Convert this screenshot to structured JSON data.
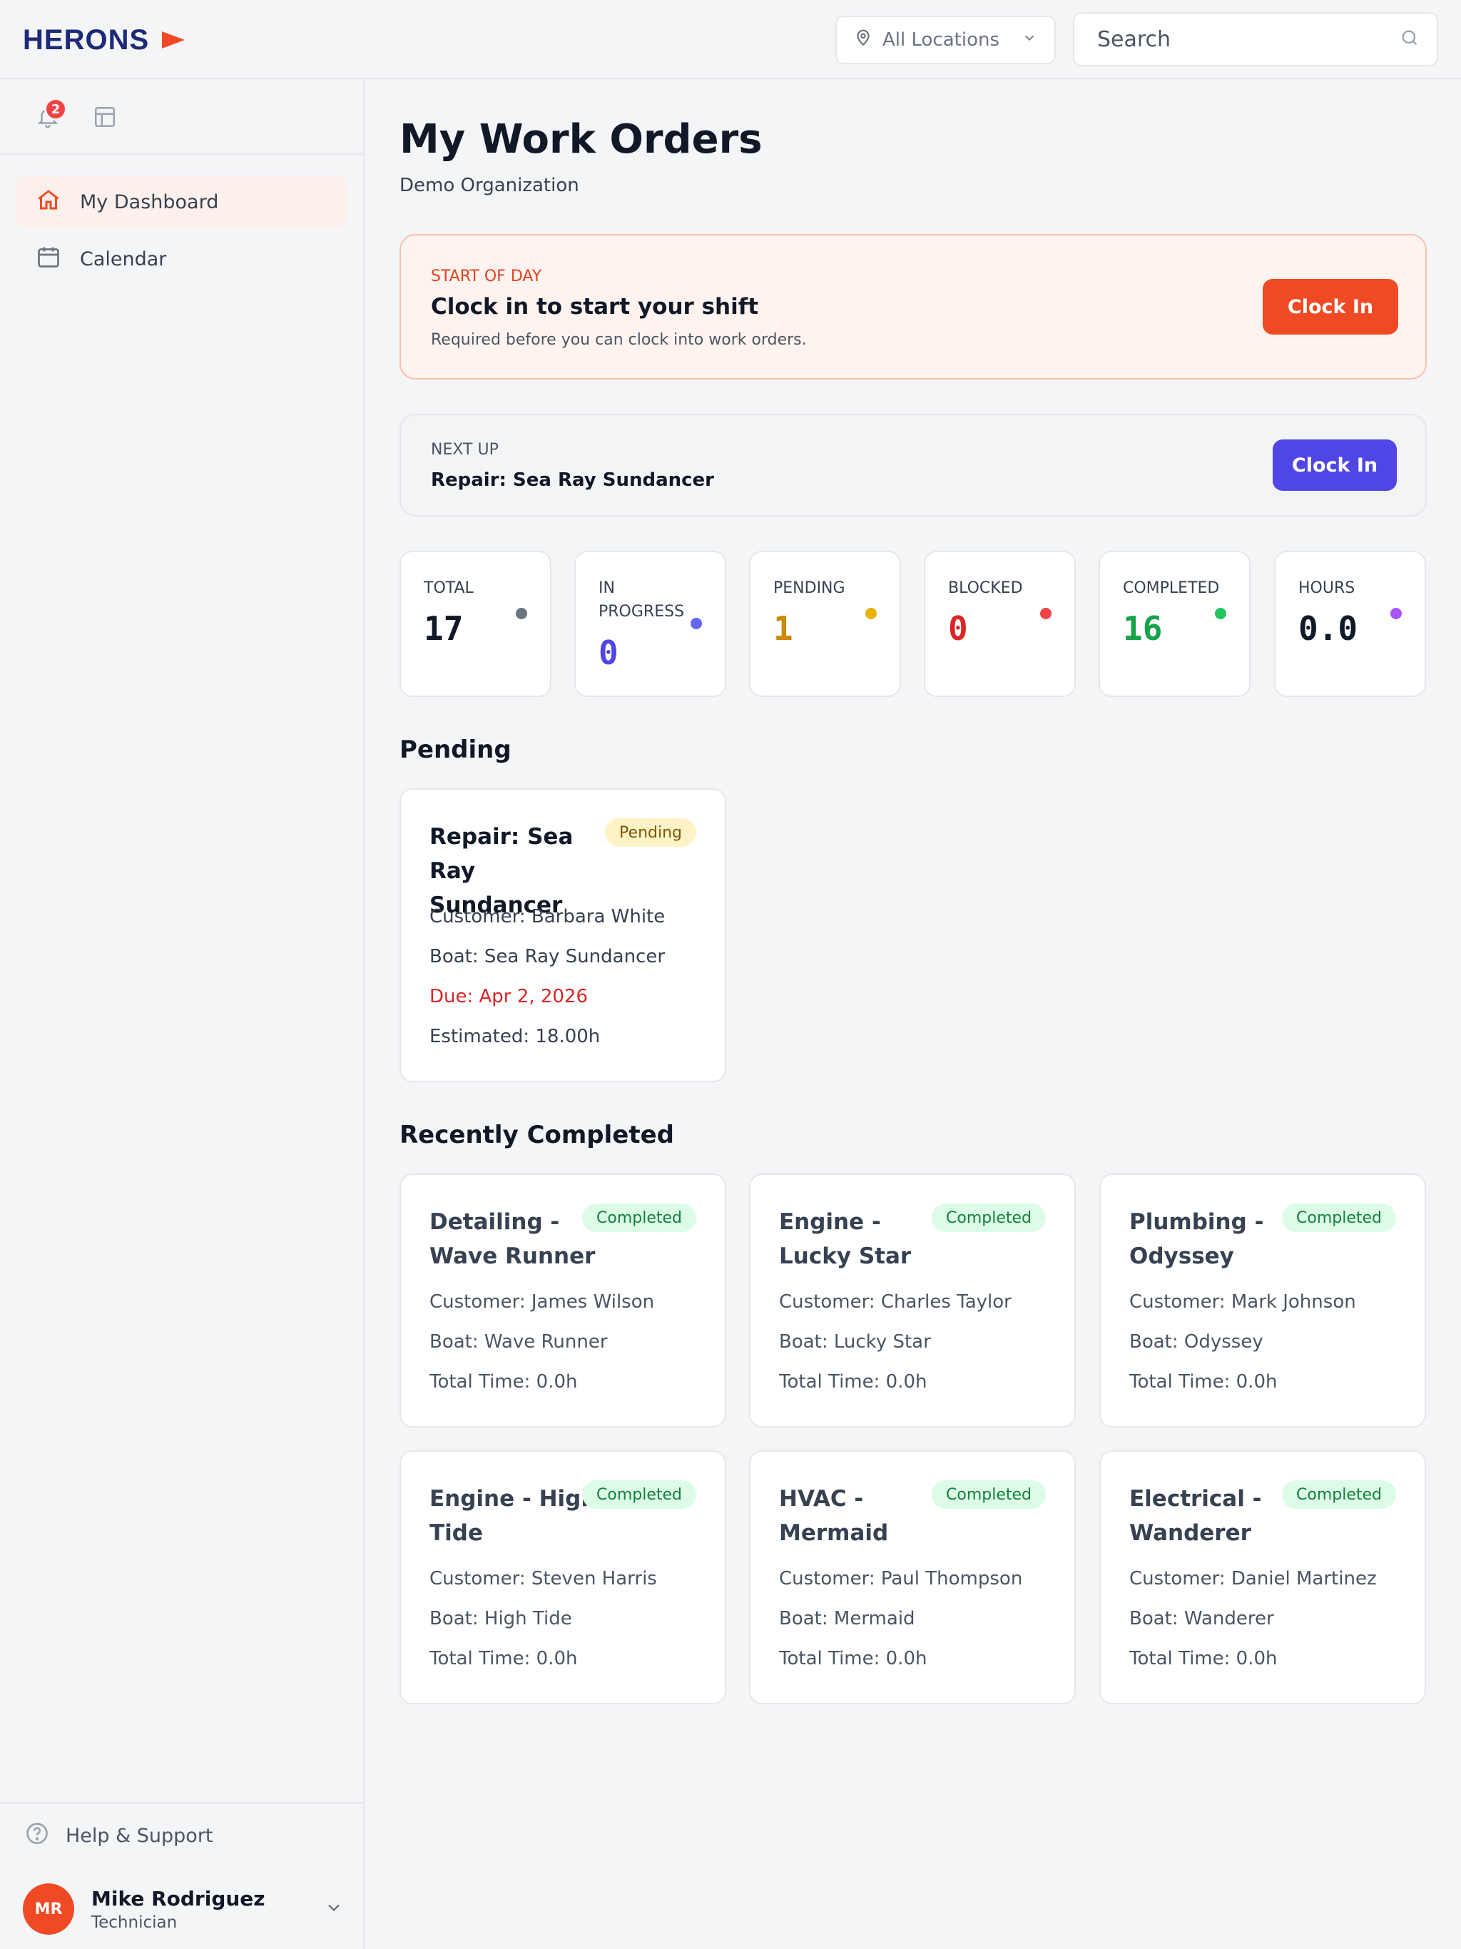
{
  "brand": {
    "name": "HERONS",
    "accent": "#f04a24",
    "navy": "#1e2a78"
  },
  "topbar": {
    "location_label": "All Locations",
    "search_placeholder": "Search"
  },
  "sidebar": {
    "notification_count": "2",
    "items": [
      {
        "label": "My Dashboard",
        "icon": "home-icon",
        "active": true
      },
      {
        "label": "Calendar",
        "icon": "calendar-icon",
        "active": false
      }
    ],
    "help_label": "Help & Support",
    "user": {
      "initials": "MR",
      "name": "Mike Rodriguez",
      "role": "Technician"
    }
  },
  "page": {
    "title": "My Work Orders",
    "subtitle": "Demo Organization"
  },
  "shift": {
    "kicker": "START OF DAY",
    "title": "Clock in to start your shift",
    "description": "Required before you can clock into work orders.",
    "button": "Clock In"
  },
  "next_up": {
    "kicker": "NEXT UP",
    "title": "Repair: Sea Ray Sundancer",
    "button": "Clock In"
  },
  "stats": [
    {
      "label": "TOTAL",
      "value": "17",
      "color": "#111827",
      "dot": "#6b7280"
    },
    {
      "label": "IN PROGRESS",
      "value": "0",
      "color": "#4f46e5",
      "dot": "#6366f1"
    },
    {
      "label": "PENDING",
      "value": "1",
      "color": "#ca8a04",
      "dot": "#eab308"
    },
    {
      "label": "BLOCKED",
      "value": "0",
      "color": "#dc2626",
      "dot": "#ef4444"
    },
    {
      "label": "COMPLETED",
      "value": "16",
      "color": "#16a34a",
      "dot": "#22c55e"
    },
    {
      "label": "HOURS",
      "value": "0.0",
      "color": "#111827",
      "dot": "#a855f7"
    }
  ],
  "pending_section": {
    "title": "Pending",
    "cards": [
      {
        "title": "Repair: Sea Ray Sundancer",
        "badge": "Pending",
        "customer": "Customer: Barbara White",
        "boat": "Boat: Sea Ray Sundancer",
        "due": "Due: Apr 2, 2026",
        "estimated": "Estimated: 18.00h"
      }
    ]
  },
  "completed_section": {
    "title": "Recently Completed",
    "cards": [
      {
        "title": "Detailing - Wave Runner",
        "badge": "Completed",
        "customer": "Customer: James Wilson",
        "boat": "Boat: Wave Runner",
        "time": "Total Time: 0.0h"
      },
      {
        "title": "Engine - Lucky Star",
        "badge": "Completed",
        "customer": "Customer: Charles Taylor",
        "boat": "Boat: Lucky Star",
        "time": "Total Time: 0.0h"
      },
      {
        "title": "Plumbing - Odyssey",
        "badge": "Completed",
        "customer": "Customer: Mark Johnson",
        "boat": "Boat: Odyssey",
        "time": "Total Time: 0.0h"
      },
      {
        "title": "Engine - High Tide",
        "badge": "Completed",
        "customer": "Customer: Steven Harris",
        "boat": "Boat: High Tide",
        "time": "Total Time: 0.0h"
      },
      {
        "title": "HVAC - Mermaid",
        "badge": "Completed",
        "customer": "Customer: Paul Thompson",
        "boat": "Boat: Mermaid",
        "time": "Total Time: 0.0h"
      },
      {
        "title": "Electrical - Wanderer",
        "badge": "Completed",
        "customer": "Customer: Daniel Martinez",
        "boat": "Boat: Wanderer",
        "time": "Total Time: 0.0h"
      }
    ]
  }
}
